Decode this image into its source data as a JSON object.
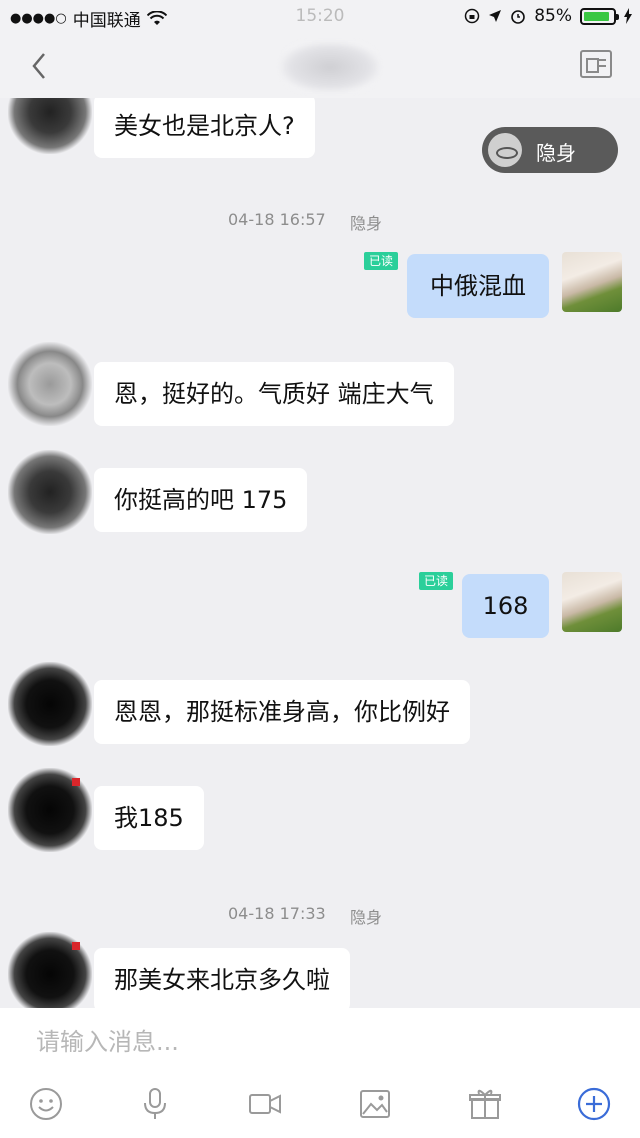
{
  "status_bar": {
    "carrier": "中国联通",
    "time": "15:20",
    "battery": "85%",
    "battery_level": 0.85
  },
  "nav": {
    "back_icon": "chevron-left-icon",
    "profile_icon": "profile-card-icon"
  },
  "stealth_toggle": {
    "label": "隐身",
    "icon": "ufo-icon"
  },
  "messages": [
    {
      "side": "left",
      "text": "美女也是北京人?"
    },
    {
      "type": "timestamp",
      "time": "04-18 16:57",
      "status": "隐身"
    },
    {
      "side": "right",
      "text": "中俄混血",
      "read": "已读"
    },
    {
      "side": "left",
      "text": "恩，挺好的。气质好 端庄大气"
    },
    {
      "side": "left",
      "text": "你挺高的吧 175"
    },
    {
      "side": "right",
      "text": "168",
      "read": "已读"
    },
    {
      "side": "left",
      "text": "恩恩，那挺标准身高，你比例好"
    },
    {
      "side": "left",
      "text": "我185"
    },
    {
      "type": "timestamp",
      "time": "04-18 17:33",
      "status": "隐身"
    },
    {
      "side": "left",
      "text": "那美女来北京多久啦"
    }
  ],
  "input": {
    "placeholder": "请输入消息..."
  },
  "toolbar": [
    "emoji-icon",
    "microphone-icon",
    "video-icon",
    "image-icon",
    "gift-icon",
    "plus-circle-icon"
  ],
  "colors": {
    "accent": "#3a6cd8",
    "read_tag": "#2bcf9a",
    "my_bubble": "#c4dcfb"
  }
}
